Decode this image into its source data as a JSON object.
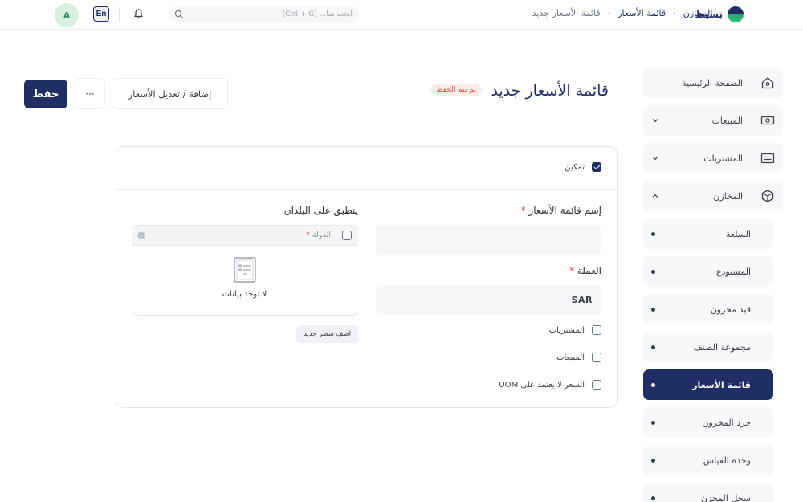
{
  "topbar": {
    "brand_name": "بسيط",
    "breadcrumbs": [
      "المخازن",
      "قائمة الأسعار",
      "قائمة الأسعار جديد"
    ],
    "search_placeholder": "ابحث هنا... (Ctrl + G)",
    "language_button": "En",
    "avatar_initial": "A"
  },
  "sidebar": {
    "items": [
      {
        "label": "الصفحة الرئيسية",
        "icon": "home-icon"
      },
      {
        "label": "المبيعات",
        "icon": "cash-icon",
        "expandable": true
      },
      {
        "label": "المشتريات",
        "icon": "receipt-icon",
        "expandable": true
      },
      {
        "label": "المخازن",
        "icon": "box-icon",
        "expandable": true,
        "expanded": true
      }
    ],
    "subitems": [
      {
        "label": "السلعة"
      },
      {
        "label": "المستودع"
      },
      {
        "label": "قيد مخزون"
      },
      {
        "label": "مجموعة الصنف"
      },
      {
        "label": "قائمة الأسعار",
        "active": true
      },
      {
        "label": "جرد المخزون"
      },
      {
        "label": "وحدة القياس"
      },
      {
        "label": "سجل المخزن"
      }
    ]
  },
  "page": {
    "title": "قائمة الأسعار جديد",
    "status_badge": "لم يتم الحفظ",
    "save_label": "حفظ",
    "more_label": "···",
    "action_label": "إضافة / تعديل الأسعار"
  },
  "form": {
    "enable_label": "تمكين",
    "enable_checked": true,
    "name_label": "إسم قائمة الأسعار",
    "name_value": "",
    "currency_label": "العملة",
    "currency_value": "SAR",
    "purchases_label": "المشتريات",
    "sales_label": "المبيعات",
    "price_not_uom_label": "السعر لا يعتمد على UOM",
    "required_mark": "*",
    "countries_title": "ينطبق على البلدان",
    "country_column": "الدولة",
    "no_data": "لا توجد بيانات",
    "add_row_label": "اضف سطر جديد"
  },
  "colors": {
    "primary": "#1f2f66",
    "danger": "#e0473c",
    "badge_bg": "#fdecea",
    "surface": "#f7f8fa"
  }
}
